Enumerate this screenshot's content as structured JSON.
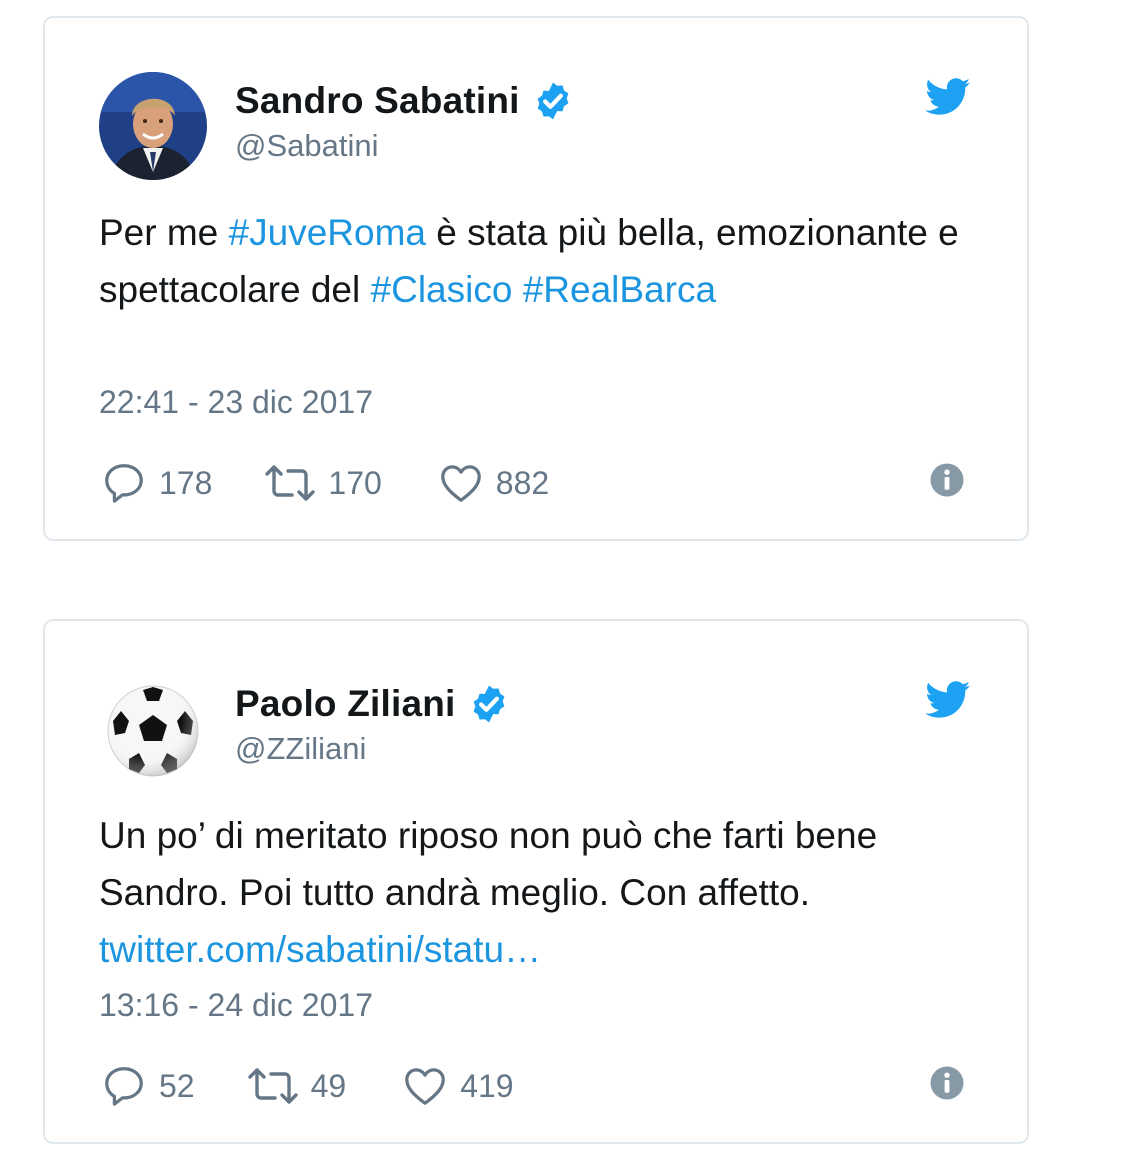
{
  "tweets": [
    {
      "name": "Sandro Sabatini",
      "handle": "@Sabatini",
      "text_parts": [
        {
          "t": "Per me ",
          "link": false
        },
        {
          "t": "#JuveRoma",
          "link": true
        },
        {
          "t": " è stata più bella, emozionante e spettacolare del ",
          "link": false
        },
        {
          "t": "#Clasico",
          "link": true
        },
        {
          "t": " ",
          "link": false
        },
        {
          "t": "#RealBarca",
          "link": true
        }
      ],
      "timestamp": "22:41 - 23 dic 2017",
      "replies": "178",
      "retweets": "170",
      "likes": "882"
    },
    {
      "name": "Paolo Ziliani",
      "handle": "@ZZiliani",
      "text_parts": [
        {
          "t": "Un po’ di meritato riposo non può che farti bene Sandro. Poi tutto andrà meglio. Con affetto. ",
          "link": false
        },
        {
          "t": "twitter.com/sabatini/statu…",
          "link": true
        }
      ],
      "timestamp": "13:16 - 24 dic 2017",
      "replies": "52",
      "retweets": "49",
      "likes": "419"
    }
  ],
  "icons": {
    "verified": "verified-badge-icon",
    "brand": "twitter-bird-icon",
    "reply": "reply-icon",
    "retweet": "retweet-icon",
    "like": "heart-icon",
    "info": "info-icon"
  },
  "colors": {
    "link": "#1b95e0",
    "verified": "#1da1f2",
    "bird": "#1da1f2",
    "muted": "#657786",
    "border": "#e1e8ed"
  }
}
